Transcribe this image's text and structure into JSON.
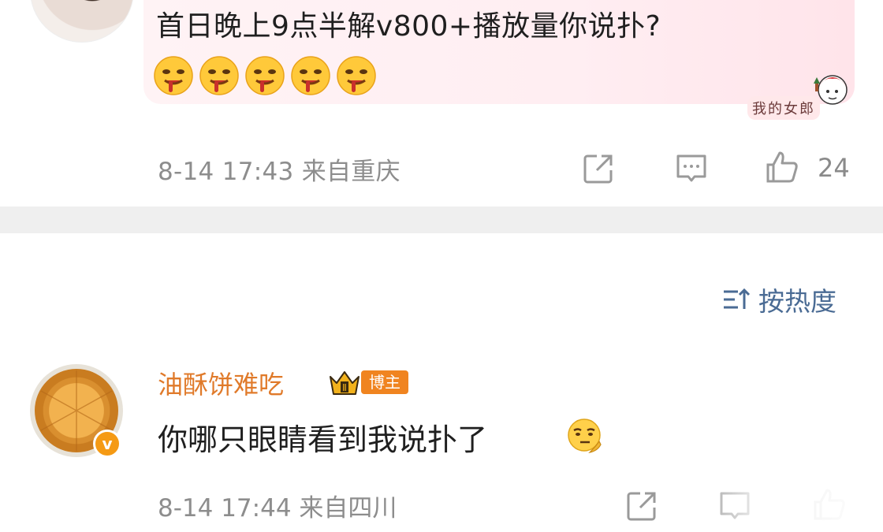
{
  "comment_top": {
    "text": "首日晚上9点半解v800+播放量你说扑?",
    "emoji_icons": [
      "drooling-face-emoji",
      "drooling-face-emoji",
      "drooling-face-emoji",
      "drooling-face-emoji",
      "drooling-face-emoji"
    ],
    "sticker_text": "我的女郎",
    "timestamp": "8-14 17:43",
    "location": "来自重庆",
    "like_count": "24"
  },
  "sort": {
    "label": "按热度",
    "icon": "sort-icon"
  },
  "comment_reply": {
    "username": "油酥饼难吃",
    "badge": "博主",
    "crown_level": "Ⅱ",
    "verified_mark": "v",
    "text": "你哪只眼睛看到我说扑了",
    "emoji_icon": "thinking-face-emoji",
    "timestamp": "8-14 17:44",
    "location": "来自四川"
  },
  "colors": {
    "username": "#e07a2a",
    "sort_link": "#4a6b94",
    "meta_gray": "#8d8d8d",
    "badge_orange": "#f08420",
    "bubble_pink": "#ffeef2",
    "separator": "#efefef"
  }
}
